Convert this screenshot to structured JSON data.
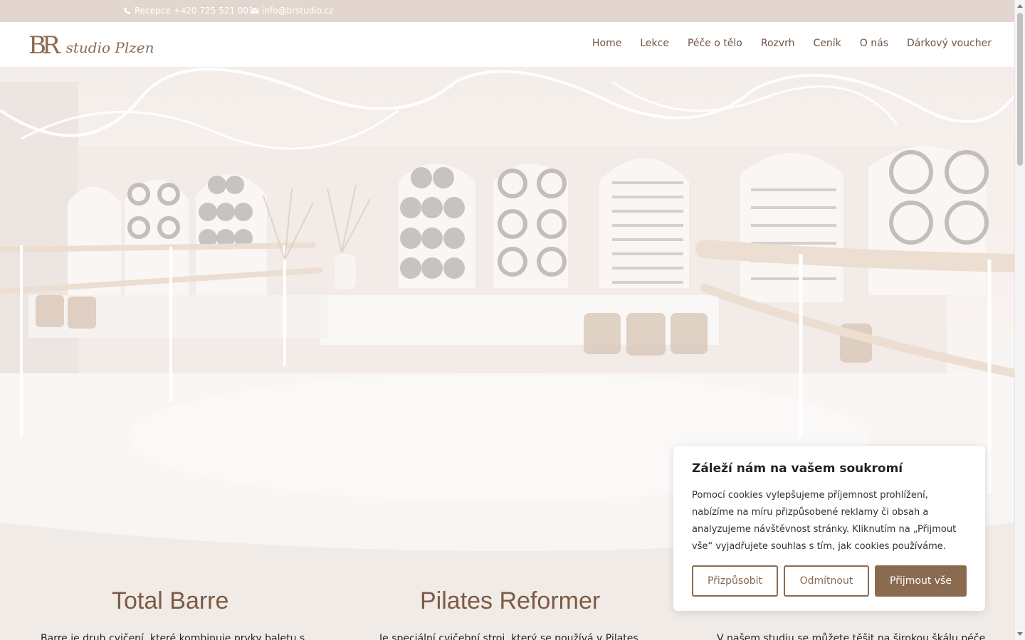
{
  "topbar": {
    "phone": "Recepce +420 725 521 001",
    "email": "info@brstudio.cz",
    "phone_icon": "phone-icon",
    "email_icon": "envelope-icon"
  },
  "header": {
    "logo_mono": "BR",
    "logo_name": "studio Plzen",
    "nav": [
      "Home",
      "Lekce",
      "Péče o tělo",
      "Rozvrh",
      "Ceník",
      "O nás",
      "Dárkový voucher"
    ]
  },
  "sections": [
    {
      "title": "Total Barre",
      "text": "Barre je druh cvičení, které kombinuje prvky baletu s"
    },
    {
      "title": "Pilates Reformer",
      "text": "Je speciální cvičební stroj, který se používá v Pilates"
    },
    {
      "title": "",
      "text": "V našem studiu se můžete těšit na širokou škálu péče"
    }
  ],
  "cookie": {
    "title": "Záleží nám na vašem soukromí",
    "body": "Pomocí cookies vylepšujeme příjemnost prohlížení, nabízíme na míru přizpůsobené reklamy či obsah a analyzujeme návštěvnost stránky. Kliknutím na „Přijmout vše“ vyjadřujete souhlas s tím, jak cookies používáme.",
    "customize": "Přizpůsobit",
    "reject": "Odmítnout",
    "accept": "Přijmout vše"
  },
  "colors": {
    "brand": "#8b6b50",
    "topbar_bg": "#e3d6cf",
    "section_bg": "#f1ebe7"
  }
}
